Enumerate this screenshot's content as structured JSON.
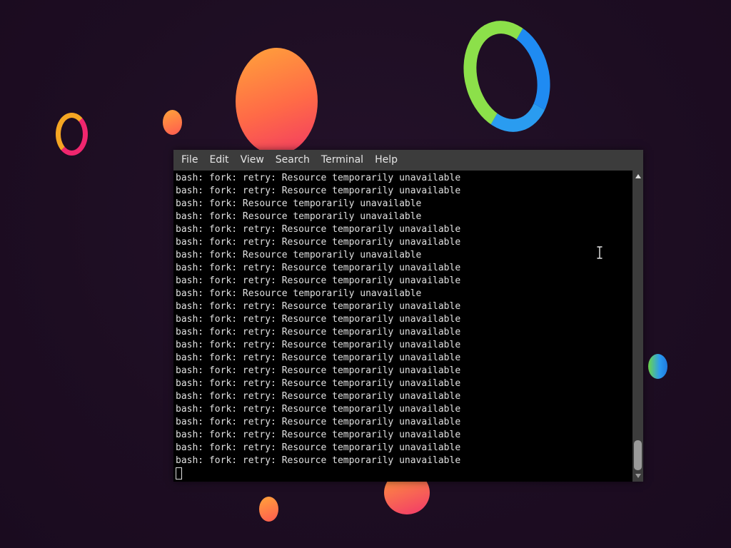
{
  "terminal": {
    "menu": [
      "File",
      "Edit",
      "View",
      "Search",
      "Terminal",
      "Help"
    ],
    "lines": [
      "bash: fork: retry: Resource temporarily unavailable",
      "bash: fork: retry: Resource temporarily unavailable",
      "bash: fork: Resource temporarily unavailable",
      "bash: fork: Resource temporarily unavailable",
      "bash: fork: retry: Resource temporarily unavailable",
      "bash: fork: retry: Resource temporarily unavailable",
      "bash: fork: Resource temporarily unavailable",
      "bash: fork: retry: Resource temporarily unavailable",
      "bash: fork: retry: Resource temporarily unavailable",
      "bash: fork: Resource temporarily unavailable",
      "bash: fork: retry: Resource temporarily unavailable",
      "bash: fork: retry: Resource temporarily unavailable",
      "bash: fork: retry: Resource temporarily unavailable",
      "bash: fork: retry: Resource temporarily unavailable",
      "bash: fork: retry: Resource temporarily unavailable",
      "bash: fork: retry: Resource temporarily unavailable",
      "bash: fork: retry: Resource temporarily unavailable",
      "bash: fork: retry: Resource temporarily unavailable",
      "bash: fork: retry: Resource temporarily unavailable",
      "bash: fork: retry: Resource temporarily unavailable",
      "bash: fork: retry: Resource temporarily unavailable",
      "bash: fork: retry: Resource temporarily unavailable",
      "bash: fork: retry: Resource temporarily unavailable"
    ],
    "colors": {
      "background": "#000000",
      "menubar": "#3c3c3c",
      "text": "#e0e0e0"
    },
    "scrollbar": {
      "position_fraction": 0.95
    }
  },
  "desktop": {
    "background": "#1f0f24",
    "icons": [
      "ring-decoration",
      "circle-decoration",
      "mouse-ibeam-icon"
    ]
  }
}
